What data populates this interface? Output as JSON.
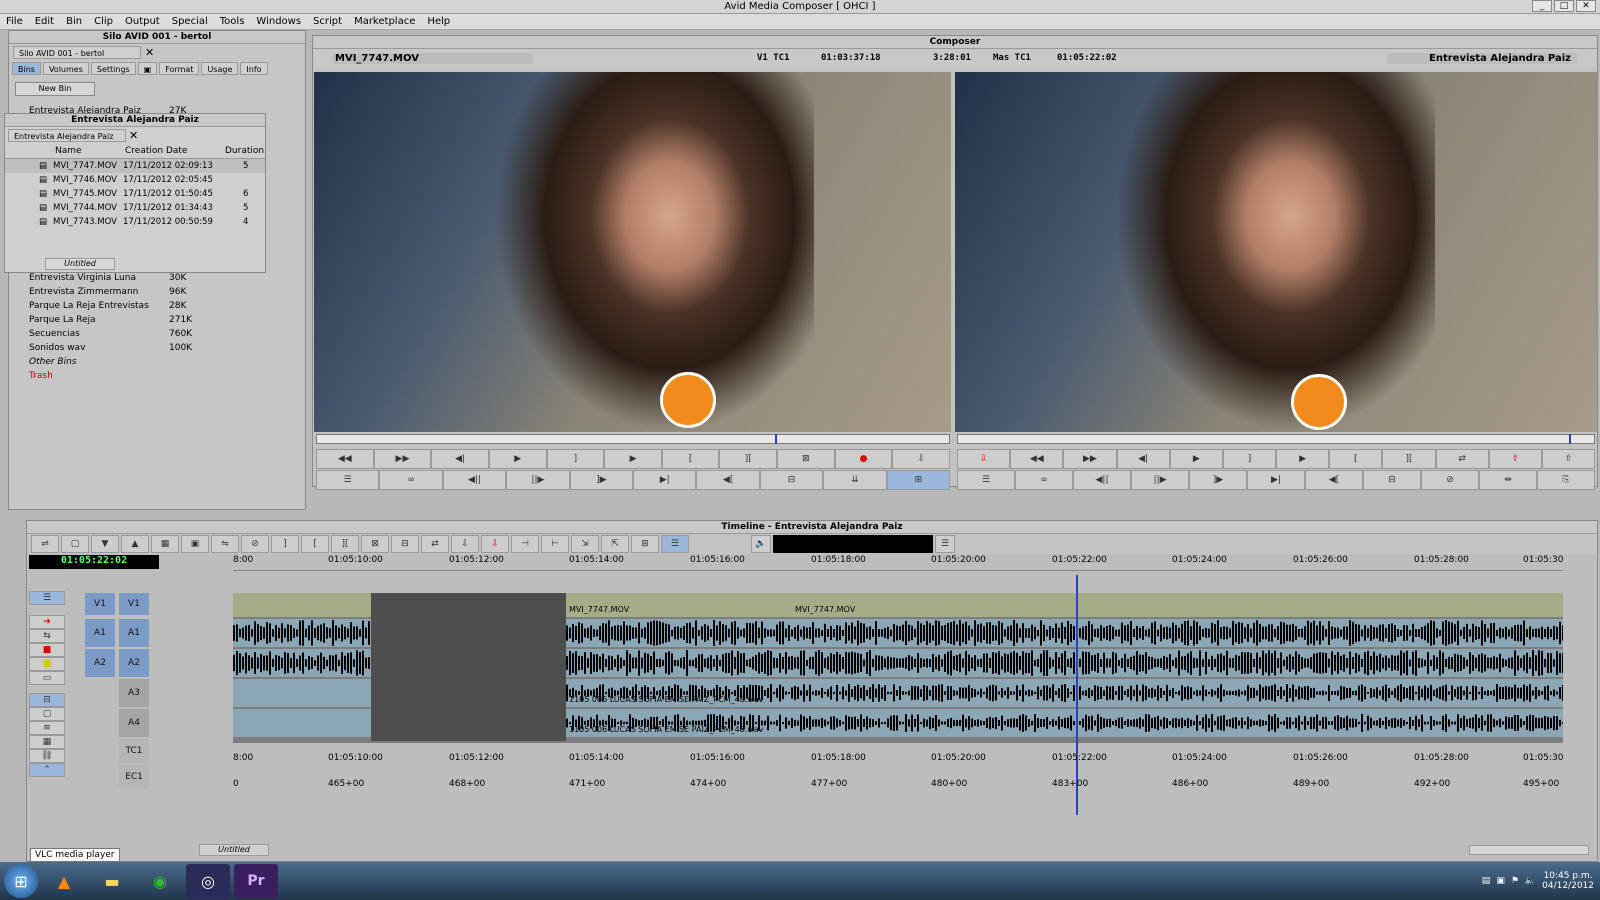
{
  "app": {
    "title": "Avid Media Composer [ OHCI ]"
  },
  "menu": [
    "File",
    "Edit",
    "Bin",
    "Clip",
    "Output",
    "Special",
    "Tools",
    "Windows",
    "Script",
    "Marketplace",
    "Help"
  ],
  "project": {
    "title": "Silo AVID 001 - bertol",
    "tab_label": "Silo AVID 001 - bertol",
    "tabs": [
      "Bins",
      "Volumes",
      "Settings",
      "",
      "Format",
      "Usage",
      "Info"
    ],
    "new_bin": "New Bin",
    "bins": [
      {
        "name": "Entrevista Alejandra Paiz",
        "size": "27K"
      },
      {
        "name": "Entrevista Virginia Luna",
        "size": "30K"
      },
      {
        "name": "Entrevista Zimmermann",
        "size": "96K"
      },
      {
        "name": "Parque La Reja Entrevistas",
        "size": "28K"
      },
      {
        "name": "Parque La Reja",
        "size": "271K"
      },
      {
        "name": "Secuencias",
        "size": "760K"
      },
      {
        "name": "Sonidos wav",
        "size": "100K"
      }
    ],
    "other_bins": "Other Bins",
    "trash": "Trash"
  },
  "bin": {
    "title": "Entrevista Alejandra Paiz",
    "tab_label": "Entrevista Alejandra Paiz",
    "columns": [
      "Name",
      "Creation Date",
      "Duration"
    ],
    "rows": [
      {
        "name": "MVI_7747.MOV",
        "date": "17/11/2012 02:09:13",
        "dur": "5"
      },
      {
        "name": "MVI_7746.MOV",
        "date": "17/11/2012 02:05:45",
        "dur": ""
      },
      {
        "name": "MVI_7745.MOV",
        "date": "17/11/2012 01:50:45",
        "dur": "6"
      },
      {
        "name": "MVI_7744.MOV",
        "date": "17/11/2012 01:34:43",
        "dur": "5"
      },
      {
        "name": "MVI_7743.MOV",
        "date": "17/11/2012 00:50:59",
        "dur": "4"
      }
    ],
    "view": "Untitled"
  },
  "composer": {
    "title": "Composer",
    "source_clip": "MVI_7747.MOV",
    "v1tc1_label": "V1 TC1",
    "v1tc1_value": "01:03:37:18",
    "duration": "3:28:01",
    "mastc1_label": "Mas TC1",
    "mastc1_value": "01:05:22:02",
    "record_seq": "Entrevista Alejandra Paiz"
  },
  "timeline": {
    "title": "Timeline - Entrevista Alejandra Paiz",
    "timecode": "01:05:22:02",
    "ruler": [
      "8:00",
      "01:05:10:00",
      "01:05:12:00",
      "01:05:14:00",
      "01:05:16:00",
      "01:05:18:00",
      "01:05:20:00",
      "01:05:22:00",
      "01:05:24:00",
      "01:05:26:00",
      "01:05:28:00",
      "01:05:30"
    ],
    "ec1": [
      "0",
      "465+00",
      "468+00",
      "471+00",
      "474+00",
      "477+00",
      "480+00",
      "483+00",
      "486+00",
      "489+00",
      "492+00",
      "495+00"
    ],
    "tracks": {
      "v1": "V1",
      "a1": "A1",
      "a2": "A2",
      "a3": "A3",
      "a4": "A4",
      "tc1": "TC1",
      "ec1": "EC1"
    },
    "clip1": "MVI_7747.MOV",
    "clip2": "MVI_7747.MOV",
    "wav_clip": "1105 006 LUCAS SOFIA EMISE PAIZ_PCM_48.wav",
    "wav_clip_b": "1105 006 LUCAS SOFIA EMISE PAIZ_PCM_48.wav",
    "view": "Untitled"
  },
  "taskbar": {
    "tooltip": "VLC media player",
    "time": "10:45 p.m.",
    "date": "04/12/2012"
  }
}
